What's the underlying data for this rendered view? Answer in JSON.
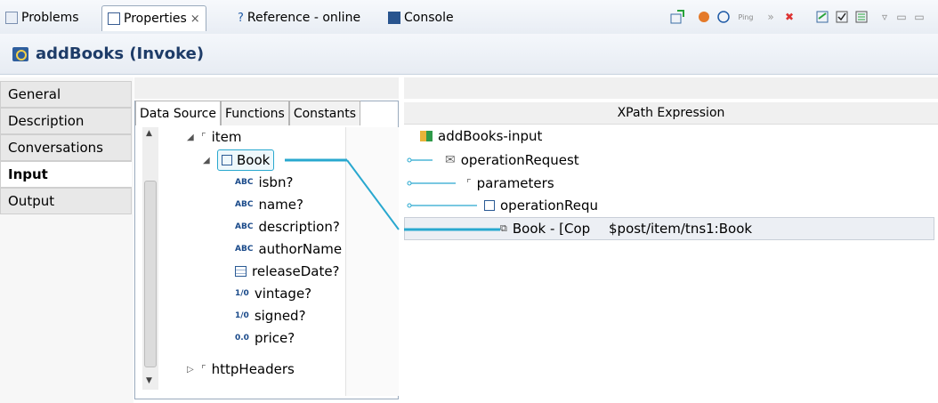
{
  "tabs": {
    "problems": "Problems",
    "properties": "Properties",
    "properties_close": "×",
    "reference": "Reference - online",
    "console": "Console",
    "ping": "Ping"
  },
  "header": {
    "title": "addBooks (Invoke)"
  },
  "nav": {
    "items": [
      "General",
      "Description",
      "Conversations",
      "Input",
      "Output"
    ],
    "selected": "Input"
  },
  "source": {
    "tabs": [
      "Data Source",
      "Functions",
      "Constants"
    ],
    "nodes": {
      "item": "item",
      "book": "Book",
      "isbn": "isbn?",
      "name": "name?",
      "description": "description?",
      "author": "authorName",
      "release": "releaseDate?",
      "vintage": "vintage?",
      "signed": "signed?",
      "price": "price?",
      "headers": "httpHeaders"
    },
    "chips": {
      "abc": "ABC",
      "bool": "1/0",
      "num": "0.0"
    }
  },
  "target": {
    "column_header": "XPath Expression",
    "nodes": {
      "input": "addBooks-input",
      "opreq": "operationRequest",
      "params": "parameters",
      "opreq2": "operationRequ",
      "book": "Book - [Cop"
    },
    "expression": "$post/item/tns1:Book"
  },
  "colors": {
    "accent": "#29a8cf",
    "title": "#1e3c68"
  }
}
